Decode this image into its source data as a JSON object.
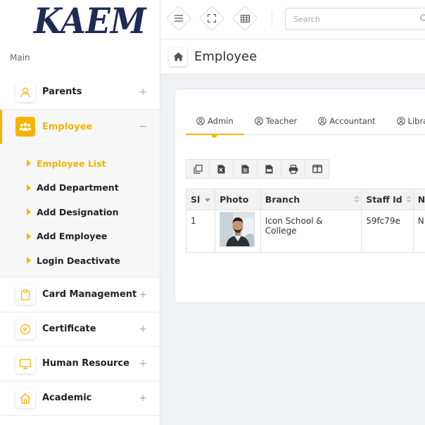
{
  "brand": {
    "logo_text": "KAEM"
  },
  "sidebar": {
    "section_label": "Main",
    "items_top": [
      {
        "label": "Parents",
        "toggle": "+",
        "icon": "person-icon"
      },
      {
        "label": "Employee",
        "toggle": "−",
        "icon": "users-icon"
      }
    ],
    "submenu": [
      {
        "label": "Employee List"
      },
      {
        "label": "Add Department"
      },
      {
        "label": "Add Designation"
      },
      {
        "label": "Add Employee"
      },
      {
        "label": "Login Deactivate"
      }
    ],
    "items_bottom": [
      {
        "label": "Card Management",
        "toggle": "+",
        "icon": "clipboard-icon"
      },
      {
        "label": "Certificate",
        "toggle": "+",
        "icon": "certificate-icon"
      },
      {
        "label": "Human Resource",
        "toggle": "+",
        "icon": "monitor-icon"
      },
      {
        "label": "Academic",
        "toggle": "+",
        "icon": "home-icon"
      }
    ]
  },
  "topbar": {
    "search_placeholder": "Search"
  },
  "page": {
    "title": "Employee"
  },
  "tabs": [
    {
      "label": "Admin"
    },
    {
      "label": "Teacher"
    },
    {
      "label": "Accountant"
    },
    {
      "label": "Libra"
    }
  ],
  "table": {
    "columns": [
      "Sl",
      "Photo",
      "Branch",
      "Staff Id",
      "N"
    ],
    "rows": [
      {
        "sl": "1",
        "branch": "Icon School & College",
        "staff_id": "59fc79e",
        "name": "N"
      }
    ]
  },
  "colors": {
    "accent": "#f6b400",
    "brand": "#1f2a55"
  }
}
